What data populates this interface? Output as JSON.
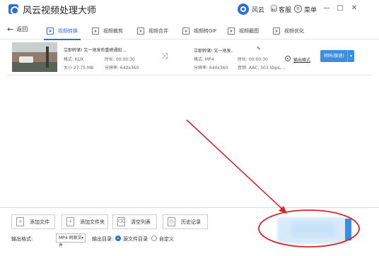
{
  "window": {
    "title": "风云视频处理大师",
    "user_name": "风云",
    "service_label": "客服",
    "menu_label": "菜单",
    "minimize_glyph": "—",
    "maximize_glyph": "□",
    "close_glyph": "✕"
  },
  "toolbar": {
    "back_label": "返回",
    "back_glyph": "←",
    "tabs": [
      {
        "label": "视频转换",
        "active": true
      },
      {
        "label": "视频裁剪",
        "active": false
      },
      {
        "label": "视频合并",
        "active": false
      },
      {
        "label": "视频转GIF",
        "active": false
      },
      {
        "label": "视频截图",
        "active": false
      },
      {
        "label": "视频优化",
        "active": false
      }
    ]
  },
  "file": {
    "source": {
      "name": "立即转储! 又一地发布重磅通知 ...",
      "format": "格式: KUX",
      "duration": "时长: 00:00:30",
      "size": "大小 27.75 MB",
      "resolution": "分辨率: 640x360"
    },
    "target": {
      "name": "立即转储! 又一地发..",
      "format": "格式: MP4",
      "duration": "时长: 00:00:30",
      "resolution": "分辨率: 640x360",
      "audio": "音频: AAC, 503 kbps,..."
    },
    "output_format_label": "输出格式",
    "convert_label": "转码(极速)",
    "convert_caret": "▾",
    "shuffle_glyph": "⤨",
    "edit_glyph": "✎"
  },
  "bottom": {
    "buttons": [
      {
        "label": "添加文件",
        "icon_glyph": "+"
      },
      {
        "label": "添加文件夹",
        "icon_glyph": "+"
      },
      {
        "label": "清空列表",
        "icon_glyph": "⌫"
      },
      {
        "label": "历史记录",
        "icon_glyph": "◷"
      }
    ],
    "output_format_label": "输出格式:",
    "output_format_value": "MP4 同原文件",
    "select_caret": "▾",
    "output_dir_label": "输出目录:",
    "dir_options": [
      {
        "label": "源文件目录",
        "selected": true
      },
      {
        "label": "自定义",
        "selected": false
      }
    ]
  },
  "colors": {
    "accent": "#2d6fd6",
    "convert_button": "#3b8ee0",
    "annotation": "#d9262b"
  },
  "icons": {
    "logo": "app-logo-icon",
    "avatar": "user-avatar-icon",
    "service": "headset-icon",
    "menu": "menu-icon",
    "back": "back-arrow-icon",
    "shuffle": "shuffle-icon",
    "edit": "pencil-icon",
    "output_format": "settings-circle-icon"
  }
}
